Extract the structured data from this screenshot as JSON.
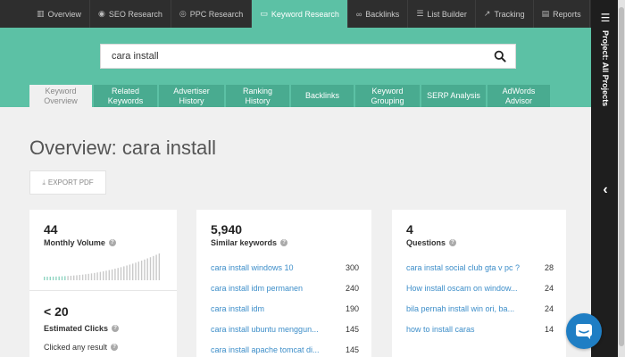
{
  "nav": {
    "items": [
      {
        "label": "Overview",
        "icon": "bar-chart-icon"
      },
      {
        "label": "SEO Research",
        "icon": "eye-icon"
      },
      {
        "label": "PPC Research",
        "icon": "target-icon"
      },
      {
        "label": "Keyword Research",
        "icon": "keyboard-icon"
      },
      {
        "label": "Backlinks",
        "icon": "link-icon"
      },
      {
        "label": "List Builder",
        "icon": "list-icon"
      },
      {
        "label": "Tracking",
        "icon": "line-chart-icon"
      },
      {
        "label": "Reports",
        "icon": "document-icon"
      }
    ],
    "active_index": 3
  },
  "search": {
    "value": "cara install"
  },
  "tabs": [
    "Keyword Overview",
    "Related Keywords",
    "Advertiser History",
    "Ranking History",
    "Backlinks",
    "Keyword Grouping",
    "SERP Analysis",
    "AdWords Advisor"
  ],
  "page": {
    "title": "Overview: cara install",
    "export_label": "EXPORT PDF"
  },
  "volume_card": {
    "value": "44",
    "label": "Monthly Volume",
    "clicks_value": "< 20",
    "clicks_label": "Estimated Clicks",
    "clicked_any": "Clicked any result"
  },
  "similar_card": {
    "value": "5,940",
    "label": "Similar keywords",
    "rows": [
      {
        "kw": "cara install windows 10",
        "n": "300"
      },
      {
        "kw": "cara install idm permanen",
        "n": "240"
      },
      {
        "kw": "cara install idm",
        "n": "190"
      },
      {
        "kw": "cara install ubuntu menggun...",
        "n": "145"
      },
      {
        "kw": "cara install apache tomcat di...",
        "n": "145"
      }
    ]
  },
  "questions_card": {
    "value": "4",
    "label": "Questions",
    "rows": [
      {
        "kw": "cara instal social club gta v pc ?",
        "n": "28"
      },
      {
        "kw": "How install oscam on window...",
        "n": "24"
      },
      {
        "kw": "bila pernah install win ori, ba...",
        "n": "24"
      },
      {
        "kw": "how to install caras",
        "n": "14"
      }
    ]
  },
  "sidebar": {
    "project_label": "Project: All Projects"
  },
  "colors": {
    "accent": "#5cc1a5",
    "tab": "#49ab90",
    "nav": "#2e2e2e",
    "link": "#3d8ec9",
    "chat": "#1f7ec4"
  }
}
